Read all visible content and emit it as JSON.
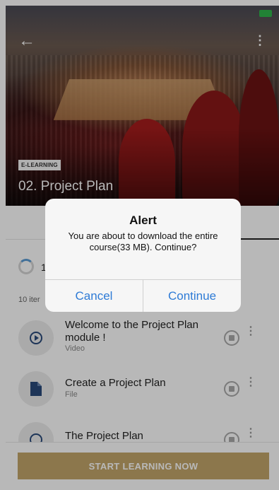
{
  "hero": {
    "badge": "E-LEARNING",
    "title": "02. Project Plan",
    "back_icon": "arrow-left-icon",
    "more_icon": "more-vertical-icon"
  },
  "progress": {
    "label": "1"
  },
  "list": {
    "count_label": "10 iter",
    "items": [
      {
        "title": "Welcome to the Project Plan module !",
        "type": "Video",
        "icon": "play-circle-icon"
      },
      {
        "title": "Create a Project Plan",
        "type": "File",
        "icon": "file-icon"
      },
      {
        "title": "The Project Plan",
        "type": "",
        "icon": "clock-icon"
      }
    ]
  },
  "cta": {
    "label": "START LEARNING NOW"
  },
  "alert": {
    "title": "Alert",
    "message": "You are about to download the entire course(33 MB). Continue?",
    "cancel_label": "Cancel",
    "continue_label": "Continue"
  },
  "colors": {
    "accent": "#c2a66a",
    "link_blue": "#2e7bd6",
    "status_green": "#2fb54a"
  }
}
